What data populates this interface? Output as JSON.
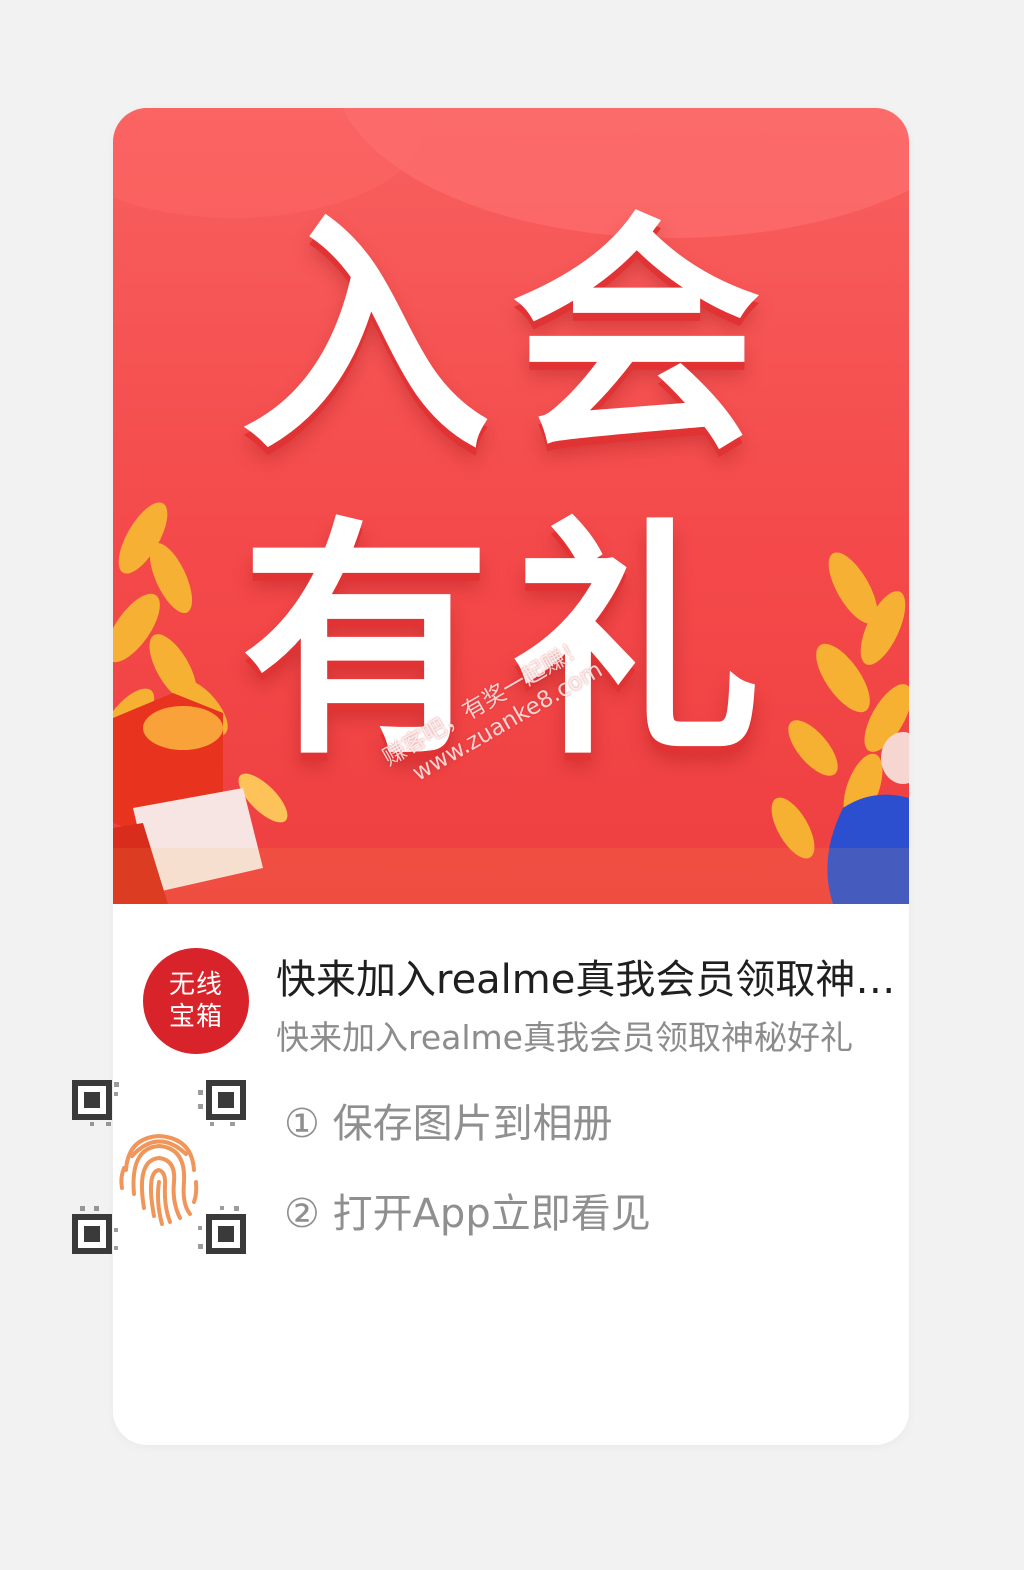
{
  "banner": {
    "line1": "入会",
    "line2": "有礼",
    "watermark_text": "赚客吧，有奖一起赚！",
    "watermark_url": "www.zuanke8.com"
  },
  "info": {
    "logo_line1": "无线",
    "logo_line2": "宝箱",
    "title": "快来加入realme真我会员领取神秘好礼",
    "subtitle": "快来加入realme真我会员领取神秘好礼"
  },
  "instructions": {
    "step1": "① 保存图片到相册",
    "step2": "② 打开App立即看见"
  },
  "colors": {
    "banner_red": "#f4494a",
    "logo_red": "#d8232a",
    "fingerprint_orange": "#f0965a",
    "text_dark": "#1f1f1f",
    "text_gray": "#8c8c8c"
  },
  "icons": {
    "qr": "qr-code-icon",
    "fingerprint": "fingerprint-icon"
  }
}
